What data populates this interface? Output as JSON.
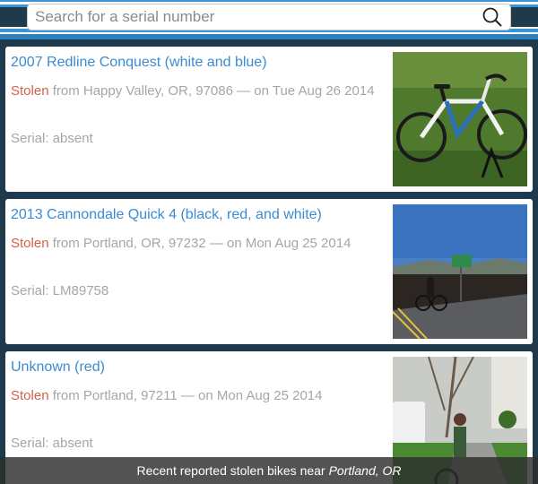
{
  "search": {
    "placeholder": "Search for a serial number"
  },
  "colors": {
    "accent": "#3a8bd1",
    "stolen": "#d4624a",
    "muted": "#a6a6a6",
    "background": "#1e3a4c"
  },
  "bikes": [
    {
      "title": "2007 Redline Conquest (white and blue)",
      "status": "Stolen",
      "details": "from Happy Valley, OR, 97086 — on Tue Aug 26 2014",
      "serial": "Serial: absent",
      "photo": "bike-photo"
    },
    {
      "title": "2013 Cannondale Quick 4 (black, red, and white)",
      "status": "Stolen",
      "details": "from Portland, OR, 97232 — on Mon Aug 25 2014",
      "serial": "Serial: LM89758",
      "photo": "bike-photo"
    },
    {
      "title": "Unknown (red)",
      "status": "Stolen",
      "details": "from Portland, 97211 — on Mon Aug 25 2014",
      "serial": "Serial: absent",
      "photo": "bike-photo"
    }
  ],
  "footer": {
    "prefix": "Recent reported stolen bikes near",
    "location": "Portland, OR"
  }
}
